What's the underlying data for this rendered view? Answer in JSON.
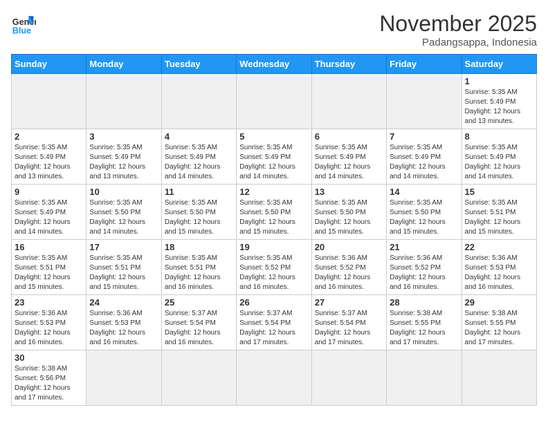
{
  "header": {
    "logo": {
      "general": "General",
      "blue": "Blue"
    },
    "title": "November 2025",
    "location": "Padangsappa, Indonesia"
  },
  "calendar": {
    "headers": [
      "Sunday",
      "Monday",
      "Tuesday",
      "Wednesday",
      "Thursday",
      "Friday",
      "Saturday"
    ],
    "weeks": [
      [
        {
          "day": "",
          "info": "",
          "empty": true
        },
        {
          "day": "",
          "info": "",
          "empty": true
        },
        {
          "day": "",
          "info": "",
          "empty": true
        },
        {
          "day": "",
          "info": "",
          "empty": true
        },
        {
          "day": "",
          "info": "",
          "empty": true
        },
        {
          "day": "",
          "info": "",
          "empty": true
        },
        {
          "day": "1",
          "info": "Sunrise: 5:35 AM\nSunset: 5:49 PM\nDaylight: 12 hours and 13 minutes.",
          "empty": false
        }
      ],
      [
        {
          "day": "2",
          "info": "Sunrise: 5:35 AM\nSunset: 5:49 PM\nDaylight: 12 hours and 13 minutes.",
          "empty": false
        },
        {
          "day": "3",
          "info": "Sunrise: 5:35 AM\nSunset: 5:49 PM\nDaylight: 12 hours and 13 minutes.",
          "empty": false
        },
        {
          "day": "4",
          "info": "Sunrise: 5:35 AM\nSunset: 5:49 PM\nDaylight: 12 hours and 14 minutes.",
          "empty": false
        },
        {
          "day": "5",
          "info": "Sunrise: 5:35 AM\nSunset: 5:49 PM\nDaylight: 12 hours and 14 minutes.",
          "empty": false
        },
        {
          "day": "6",
          "info": "Sunrise: 5:35 AM\nSunset: 5:49 PM\nDaylight: 12 hours and 14 minutes.",
          "empty": false
        },
        {
          "day": "7",
          "info": "Sunrise: 5:35 AM\nSunset: 5:49 PM\nDaylight: 12 hours and 14 minutes.",
          "empty": false
        },
        {
          "day": "8",
          "info": "Sunrise: 5:35 AM\nSunset: 5:49 PM\nDaylight: 12 hours and 14 minutes.",
          "empty": false
        }
      ],
      [
        {
          "day": "9",
          "info": "Sunrise: 5:35 AM\nSunset: 5:49 PM\nDaylight: 12 hours and 14 minutes.",
          "empty": false
        },
        {
          "day": "10",
          "info": "Sunrise: 5:35 AM\nSunset: 5:50 PM\nDaylight: 12 hours and 14 minutes.",
          "empty": false
        },
        {
          "day": "11",
          "info": "Sunrise: 5:35 AM\nSunset: 5:50 PM\nDaylight: 12 hours and 15 minutes.",
          "empty": false
        },
        {
          "day": "12",
          "info": "Sunrise: 5:35 AM\nSunset: 5:50 PM\nDaylight: 12 hours and 15 minutes.",
          "empty": false
        },
        {
          "day": "13",
          "info": "Sunrise: 5:35 AM\nSunset: 5:50 PM\nDaylight: 12 hours and 15 minutes.",
          "empty": false
        },
        {
          "day": "14",
          "info": "Sunrise: 5:35 AM\nSunset: 5:50 PM\nDaylight: 12 hours and 15 minutes.",
          "empty": false
        },
        {
          "day": "15",
          "info": "Sunrise: 5:35 AM\nSunset: 5:51 PM\nDaylight: 12 hours and 15 minutes.",
          "empty": false
        }
      ],
      [
        {
          "day": "16",
          "info": "Sunrise: 5:35 AM\nSunset: 5:51 PM\nDaylight: 12 hours and 15 minutes.",
          "empty": false
        },
        {
          "day": "17",
          "info": "Sunrise: 5:35 AM\nSunset: 5:51 PM\nDaylight: 12 hours and 15 minutes.",
          "empty": false
        },
        {
          "day": "18",
          "info": "Sunrise: 5:35 AM\nSunset: 5:51 PM\nDaylight: 12 hours and 16 minutes.",
          "empty": false
        },
        {
          "day": "19",
          "info": "Sunrise: 5:35 AM\nSunset: 5:52 PM\nDaylight: 12 hours and 16 minutes.",
          "empty": false
        },
        {
          "day": "20",
          "info": "Sunrise: 5:36 AM\nSunset: 5:52 PM\nDaylight: 12 hours and 16 minutes.",
          "empty": false
        },
        {
          "day": "21",
          "info": "Sunrise: 5:36 AM\nSunset: 5:52 PM\nDaylight: 12 hours and 16 minutes.",
          "empty": false
        },
        {
          "day": "22",
          "info": "Sunrise: 5:36 AM\nSunset: 5:53 PM\nDaylight: 12 hours and 16 minutes.",
          "empty": false
        }
      ],
      [
        {
          "day": "23",
          "info": "Sunrise: 5:36 AM\nSunset: 5:53 PM\nDaylight: 12 hours and 16 minutes.",
          "empty": false
        },
        {
          "day": "24",
          "info": "Sunrise: 5:36 AM\nSunset: 5:53 PM\nDaylight: 12 hours and 16 minutes.",
          "empty": false
        },
        {
          "day": "25",
          "info": "Sunrise: 5:37 AM\nSunset: 5:54 PM\nDaylight: 12 hours and 16 minutes.",
          "empty": false
        },
        {
          "day": "26",
          "info": "Sunrise: 5:37 AM\nSunset: 5:54 PM\nDaylight: 12 hours and 17 minutes.",
          "empty": false
        },
        {
          "day": "27",
          "info": "Sunrise: 5:37 AM\nSunset: 5:54 PM\nDaylight: 12 hours and 17 minutes.",
          "empty": false
        },
        {
          "day": "28",
          "info": "Sunrise: 5:38 AM\nSunset: 5:55 PM\nDaylight: 12 hours and 17 minutes.",
          "empty": false
        },
        {
          "day": "29",
          "info": "Sunrise: 5:38 AM\nSunset: 5:55 PM\nDaylight: 12 hours and 17 minutes.",
          "empty": false
        }
      ],
      [
        {
          "day": "30",
          "info": "Sunrise: 5:38 AM\nSunset: 5:56 PM\nDaylight: 12 hours and 17 minutes.",
          "empty": false
        },
        {
          "day": "",
          "info": "",
          "empty": true
        },
        {
          "day": "",
          "info": "",
          "empty": true
        },
        {
          "day": "",
          "info": "",
          "empty": true
        },
        {
          "day": "",
          "info": "",
          "empty": true
        },
        {
          "day": "",
          "info": "",
          "empty": true
        },
        {
          "day": "",
          "info": "",
          "empty": true
        }
      ]
    ]
  }
}
